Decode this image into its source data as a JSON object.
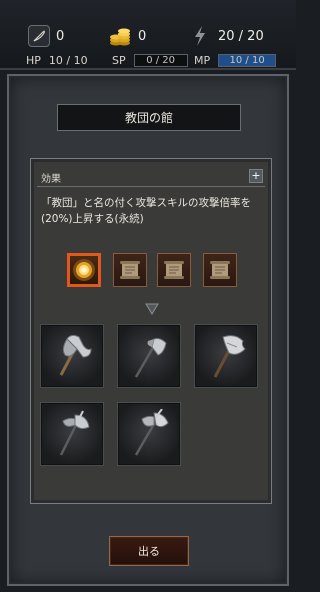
{
  "status": {
    "feather_count": "0",
    "gold_count": "0",
    "energy": "20 / 20"
  },
  "stats": {
    "hp_label": "HP",
    "hp_value": "10 / 10",
    "sp_label": "SP",
    "sp_value": "0 / 20",
    "sp_fraction": 0,
    "mp_label": "MP",
    "mp_value": "10 / 10",
    "mp_fraction": 1
  },
  "dialog": {
    "title": "教団の館",
    "effect_label": "効果",
    "plus": "+",
    "description": "「教団」と名の付く攻撃スキルの攻撃倍率を(20%)上昇する(永続)",
    "exit_label": "出る"
  },
  "icons": {
    "feather": "feather-quill-icon",
    "gold": "gold-coins-icon",
    "energy": "lightning-bolt-icon",
    "selected_tome": "glowing-tome-icon",
    "scroll": "parchment-scroll-icon",
    "arrow": "triangle-down-icon",
    "weapons": [
      "double-axe-icon",
      "poleaxe-icon",
      "broad-axe-icon",
      "halberd-icon",
      "battle-axe-icon"
    ]
  },
  "colors": {
    "mp_fill": "#1f4f8a",
    "selected_border": "#e2571b"
  }
}
